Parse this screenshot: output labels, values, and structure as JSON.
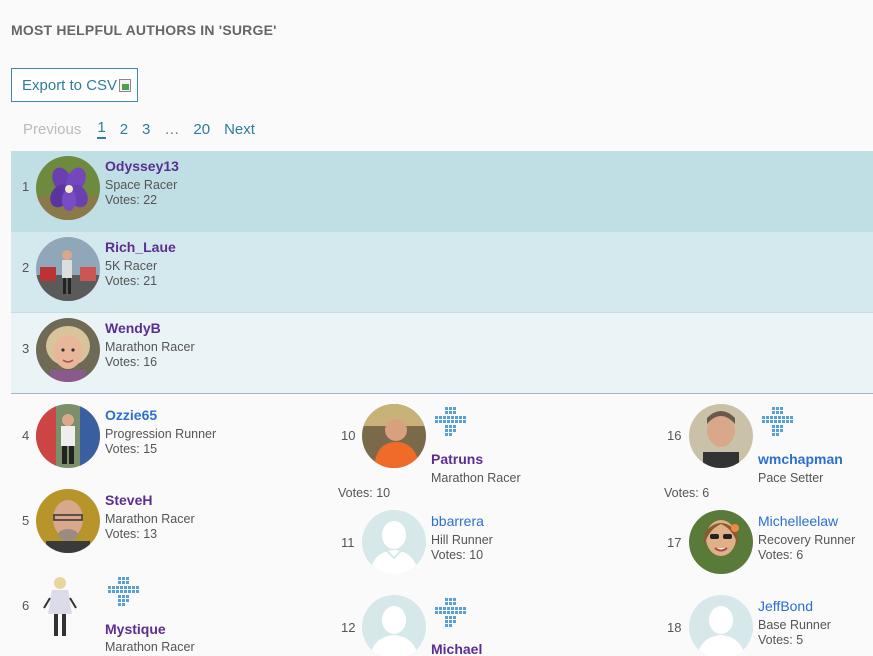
{
  "title": "MOST HELPFUL AUTHORS IN 'SURGE'",
  "export_label": "Export to CSV",
  "pager": {
    "previous": "Previous",
    "pages": [
      "1",
      "2",
      "3"
    ],
    "ellipsis": "…",
    "last": "20",
    "next": "Next"
  },
  "top": [
    {
      "rank": "1",
      "name": "Odyssey13",
      "title": "Space Racer",
      "votes": "Votes: 22"
    },
    {
      "rank": "2",
      "name": "Rich_Laue",
      "title": "5K Racer",
      "votes": "Votes: 21"
    },
    {
      "rank": "3",
      "name": "WendyB",
      "title": "Marathon Racer",
      "votes": "Votes: 16"
    }
  ],
  "col1": [
    {
      "rank": "4",
      "name": "Ozzie65",
      "title": "Progression Runner",
      "votes": "Votes: 15"
    },
    {
      "rank": "5",
      "name": "SteveH",
      "title": "Marathon Racer",
      "votes": "Votes: 13"
    },
    {
      "rank": "6",
      "name": "Mystique",
      "title": "Marathon Racer",
      "votes": ""
    }
  ],
  "col2": [
    {
      "rank": "10",
      "name": "Patruns",
      "title": "Marathon Racer",
      "votes": "Votes: 10"
    },
    {
      "rank": "11",
      "name": "bbarrera",
      "title": "Hill Runner",
      "votes": "Votes: 10"
    },
    {
      "rank": "12",
      "name": "Michael",
      "title": "",
      "votes": ""
    }
  ],
  "col3": [
    {
      "rank": "16",
      "name": "wmchapman",
      "title": "Pace Setter",
      "votes": "Votes: 6"
    },
    {
      "rank": "17",
      "name": "Michelleelaw",
      "title": "Recovery Runner",
      "votes": "Votes: 6"
    },
    {
      "rank": "18",
      "name": "JeffBond",
      "title": "Base Runner",
      "votes": "Votes: 5"
    }
  ],
  "colors": {
    "row1": "#bfdfe4",
    "row2": "#d4e9ee",
    "row3": "#eaf4f6",
    "name_purple": "#5b2e91",
    "name_blue": "#2a6fd1",
    "link": "#2e7d9b"
  }
}
